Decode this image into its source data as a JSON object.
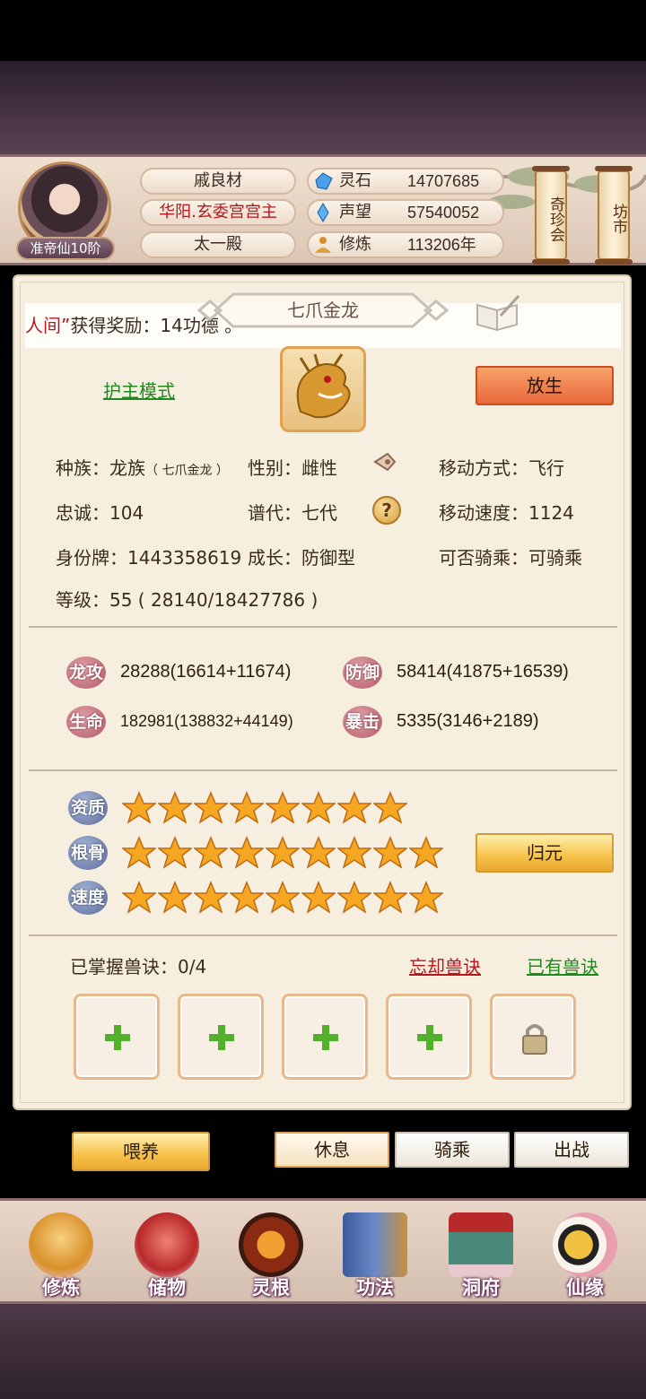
{
  "player": {
    "name": "戚良材",
    "title": "华阳.玄委宫宫主",
    "sect": "太一殿",
    "rank": "准帝仙10阶"
  },
  "resources": [
    {
      "icon": "spirit-stone-icon",
      "label": "灵石",
      "value": "14707685"
    },
    {
      "icon": "reputation-icon",
      "label": "声望",
      "value": "57540052"
    },
    {
      "icon": "cultivation-icon",
      "label": "修炼",
      "value": "113206年"
    }
  ],
  "side_buttons": {
    "treasure": "奇珍会",
    "market": "坊市"
  },
  "ticker": {
    "highlight": "人间”",
    "text": "获得奖励：14功德 。"
  },
  "beast": {
    "name": "七爪金龙",
    "guard_mode": "护主模式",
    "release": "放生",
    "race_label": "种族：龙族",
    "race_sub": "（ 七爪金龙 ）",
    "gender": "性别：雌性",
    "movement": "移动方式：飞行",
    "loyalty": "忠诚：104",
    "generation": "谱代：七代",
    "speed": "移动速度：1124",
    "id_tag": "身份牌：1443358619",
    "growth": "成长：防御型",
    "rideable": "可否骑乘：可骑乘",
    "level": "等级：55 ( 28140/18427786 )",
    "help_glyph": "?"
  },
  "stats": [
    {
      "label": "龙攻",
      "value": "28288(16614+11674)"
    },
    {
      "label": "防御",
      "value": "58414(41875+16539)"
    },
    {
      "label": "生命",
      "value": "182981(138832+44149)"
    },
    {
      "label": "暴击",
      "value": "5335(3146+2189)"
    }
  ],
  "aptitude": [
    {
      "label": "资质",
      "stars": 8
    },
    {
      "label": "根骨",
      "stars": 9
    },
    {
      "label": "速度",
      "stars": 9
    }
  ],
  "return_origin": "归元",
  "skills": {
    "mastered": "已掌握兽诀：0/4",
    "forget": "忘却兽诀",
    "owned": "已有兽诀"
  },
  "actions": {
    "feed": "喂养",
    "rest": "休息",
    "ride": "骑乘",
    "battle": "出战"
  },
  "nav": [
    "修炼",
    "储物",
    "灵根",
    "功法",
    "洞府",
    "仙缘"
  ],
  "colors": {
    "accent_red": "#b8161c",
    "accent_green": "#1e8a1e",
    "button_orange": "#e8683a",
    "button_gold": "#f6c24a"
  }
}
